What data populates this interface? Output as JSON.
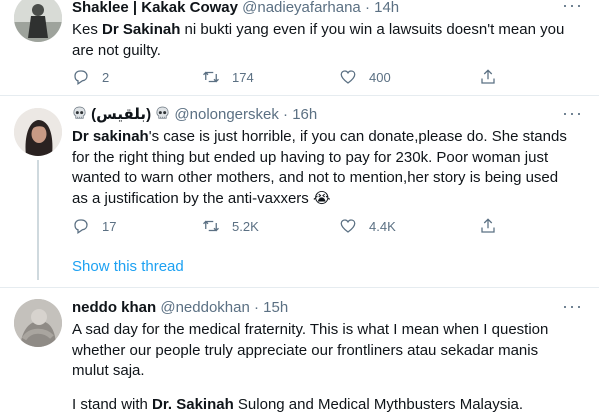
{
  "tweets": [
    {
      "name": "Shaklee | Kakak Coway",
      "handle": "@nadieyafarhana",
      "sep": "·",
      "time": "14h",
      "text_pre": "Kes ",
      "text_bold": "Dr Sakinah",
      "text_post": " ni bukti yang even if you win a lawsuits doesn't mean you are not guilty.",
      "replies": "2",
      "retweets": "174",
      "likes": "400"
    },
    {
      "name_arabic": "(بلقيس)",
      "handle": "@nolongerskek",
      "sep": "·",
      "time": "16h",
      "text_bold": "Dr sakinah",
      "text_post": "'s case is just horrible, if you can donate,please do. She stands for the right thing but ended up having to pay for 230k. Poor woman just wanted to warn other mothers, and not to mention,her story is being used as a justification by the anti-vaxxers",
      "emoji": "😭",
      "replies": "17",
      "retweets": "5.2K",
      "likes": "4.4K",
      "show_thread": "Show this thread"
    },
    {
      "name": "neddo khan",
      "handle": "@neddokhan",
      "sep": "·",
      "time": "15h",
      "text_1": "A sad day for the medical fraternity. This is what I mean when I question whether our people truly appreciate our frontliners atau sekadar manis mulut saja.",
      "text_2_pre": "I stand with ",
      "text_2_bold": "Dr. Sakinah",
      "text_2_post": " Sulong and Medical Mythbusters Malaysia."
    }
  ],
  "icons": [
    "reply-icon",
    "retweet-icon",
    "like-icon",
    "share-icon",
    "more-icon",
    "skull-icon"
  ],
  "colors": {
    "secondary": "#5b7083",
    "link": "#1da1f2",
    "divider": "#e6ecf0",
    "text": "#0f1419"
  }
}
